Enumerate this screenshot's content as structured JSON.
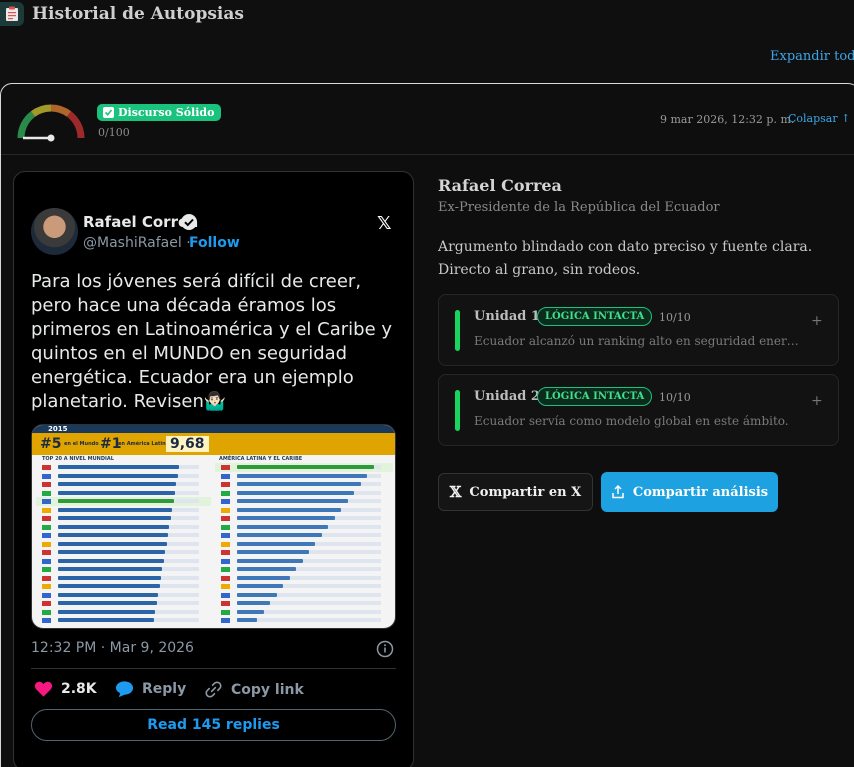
{
  "app": {
    "title": "Historial de Autopsias",
    "icon": "clipboard-icon"
  },
  "toolbar": {
    "expand_all": "Expandir todos"
  },
  "entry": {
    "badge": "Discurso Sólido",
    "score_text": "0/100",
    "score_value": 0,
    "timestamp": "9 mar 2026, 12:32 p. m.",
    "collapse_label": "Colapsar ↑"
  },
  "tweet": {
    "author": "Rafael Correa",
    "handle": "@MashiRafael",
    "separator": "·",
    "follow": "Follow",
    "text": "Para los jóvenes será difícil de creer, pero hace una década éramos los primeros en Latinoamérica y el Caribe y quintos en el MUNDO en seguridad energética. Ecuador era un ejemplo planetario. Revisen🤷🏻‍♂️",
    "image": {
      "year": "2015",
      "stat1_big": "#5",
      "stat1_small": "en el Mundo",
      "stat2_big": "#1",
      "stat2_small": "en América Latina",
      "stat3_big": "9,68",
      "col_left": "TOP 20 A NIVEL MUNDIAL",
      "col_right": "AMÉRICA LATINA Y EL CARIBE"
    },
    "time": "12:32 PM · Mar 9, 2026",
    "likes": "2.8K",
    "reply": "Reply",
    "copy_link": "Copy link",
    "read_replies": "Read 145 replies"
  },
  "analysis": {
    "speaker_name": "Rafael Correa",
    "speaker_role": "Ex-Presidente de la República del Ecuador",
    "summary": "Argumento blindado con dato preciso y fuente clara. Directo al grano, sin rodeos.",
    "units": [
      {
        "title": "Unidad 1",
        "badge": "LÓGICA INTACTA",
        "score": "10/10",
        "plus": "+",
        "desc": "Ecuador alcanzó un ranking alto en seguridad energética…"
      },
      {
        "title": "Unidad 2",
        "badge": "LÓGICA INTACTA",
        "score": "10/10",
        "plus": "+",
        "desc": "Ecuador servía como modelo global en este ámbito."
      }
    ],
    "share_x": "Compartir en X",
    "share_analysis": "Compartir análisis"
  },
  "colors": {
    "accent": "#3ea6e8",
    "success": "#19c37d",
    "share": "#1da1e0"
  }
}
